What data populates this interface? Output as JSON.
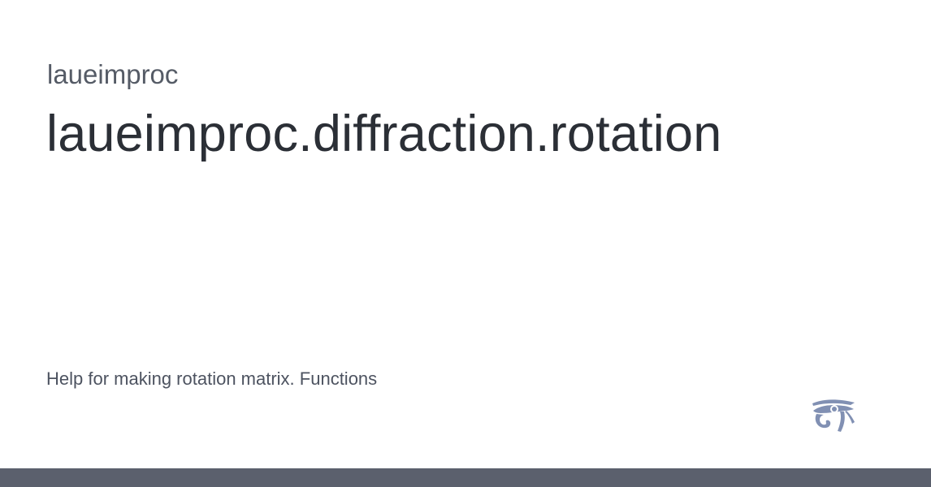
{
  "header": {
    "package_name": "laueimproc",
    "module_title": "laueimproc.diffraction.rotation"
  },
  "main": {
    "description": "Help for making rotation matrix. Functions"
  },
  "footer": {
    "logo_icon": "eye-of-horus-icon",
    "bar_color": "#5b606d"
  },
  "colors": {
    "logo": "#8190b3",
    "title": "#2b2f36",
    "subtitle": "#555b66",
    "description": "#4d5360"
  }
}
